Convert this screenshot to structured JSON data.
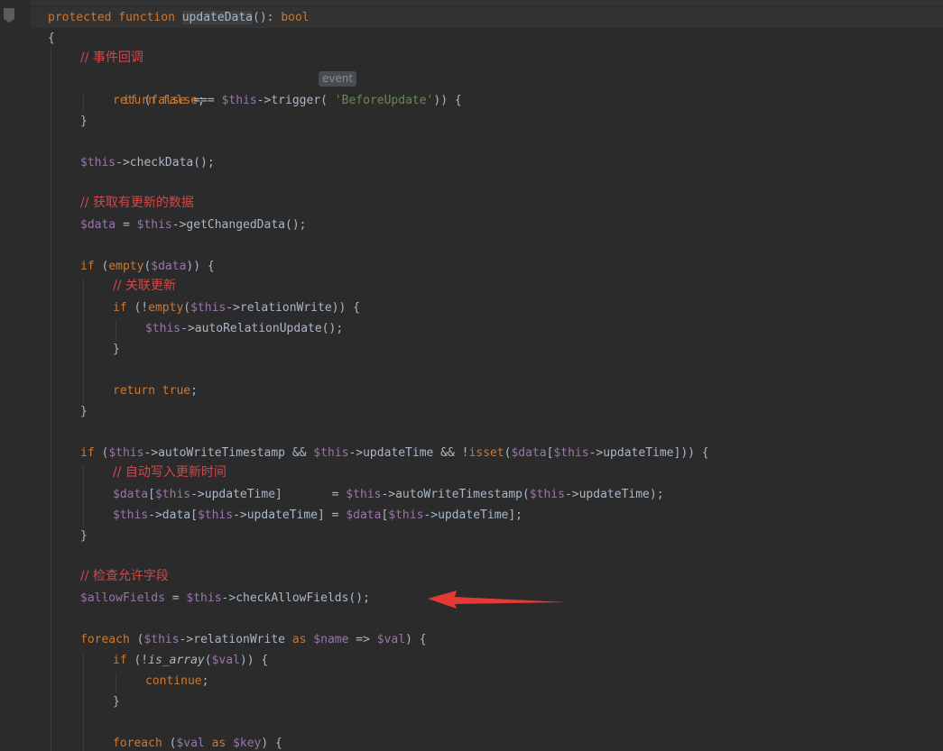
{
  "editor": {
    "colors": {
      "background": "#2b2b2b",
      "keyword": "#cc7832",
      "variable": "#9876aa",
      "string": "#6a8759",
      "comment": "#d14848",
      "text": "#a9b7c6",
      "annotation_arrow": "#e53935"
    },
    "icons": {
      "bookmark": "bookmark-icon",
      "annotation": "red-arrow-icon"
    },
    "param_hint": "event",
    "code": {
      "l01_sig": "protected function updateData(): bool",
      "l02_brace": "{",
      "l03_comment": "// 事件回调",
      "l04_if_trigger": "if (false === $this->trigger( 'BeforeUpdate')) {",
      "l05_return_false": "return false;",
      "l06_close": "}",
      "l08_checkdata": "$this->checkData();",
      "l10_comment": "// 获取有更新的数据",
      "l11_getchanged": "$data = $this->getChangedData();",
      "l13_if_empty": "if (empty($data)) {",
      "l14_comment": "// 关联更新",
      "l15_if_relation": "if (!empty($this->relationWrite)) {",
      "l16_auto_update": "$this->autoRelationUpdate();",
      "l17_close": "}",
      "l19_return_true": "return true;",
      "l20_close": "}",
      "l22_if_timestamp": "if ($this->autoWriteTimestamp && $this->updateTime && !isset($data[$this->updateTime])) {",
      "l23_comment": "// 自动写入更新时间",
      "l24_assign_data": "$data[$this->updateTime]       = $this->autoWriteTimestamp($this->updateTime);",
      "l25_assign_this": "$this->data[$this->updateTime] = $data[$this->updateTime];",
      "l26_close": "}",
      "l28_comment": "// 检查允许字段",
      "l29_allowfields": "$allowFields = $this->checkAllowFields();",
      "l31_foreach": "foreach ($this->relationWrite as $name => $val) {",
      "l32_if_isarray": "if (!is_array($val)) {",
      "l33_continue": "continue;",
      "l34_close": "}",
      "l36_foreach_val": "foreach ($val as $key) {"
    }
  }
}
